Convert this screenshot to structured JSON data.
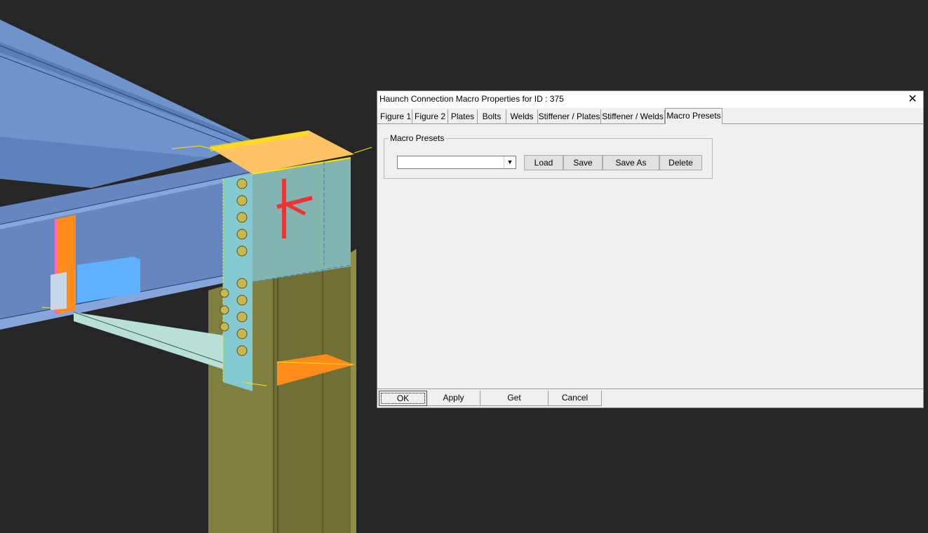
{
  "dialog": {
    "title": "Haunch Connection Macro Properties for ID : 375",
    "close_glyph": "✕",
    "tabs": [
      {
        "label": "Figure 1"
      },
      {
        "label": "Figure 2"
      },
      {
        "label": "Plates"
      },
      {
        "label": "Bolts"
      },
      {
        "label": "Welds"
      },
      {
        "label": "Stiffener / Plates"
      },
      {
        "label": "Stiffener / Welds"
      },
      {
        "label": "Macro Presets"
      }
    ],
    "active_tab": "Macro Presets",
    "macro_presets": {
      "group_label": "Macro Presets",
      "preset_value": "",
      "load_label": "Load",
      "save_label": "Save",
      "save_as_label": "Save As",
      "delete_label": "Delete"
    },
    "footer": {
      "ok_label": "OK",
      "apply_label": "Apply",
      "get_label": "Get",
      "cancel_label": "Cancel"
    }
  },
  "colors": {
    "background": "#262626",
    "beam_blue": "#6f94cc",
    "column_olive": "#7f7f40",
    "end_plate_cyan": "#84c8d0",
    "stiffener_orange": "#ff8c1a",
    "top_plate": "#ffc266",
    "weld_yellow": "#ffe600",
    "bolt": "#c8b850",
    "marker_red": "#ee3333",
    "dialog_bg": "#f0f0f0"
  }
}
